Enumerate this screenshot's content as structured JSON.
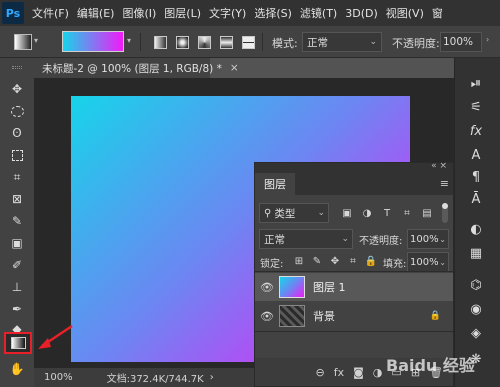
{
  "menu": {
    "logo": "Ps",
    "items": [
      "文件(F)",
      "编辑(E)",
      "图像(I)",
      "图层(L)",
      "文字(Y)",
      "选择(S)",
      "滤镜(T)",
      "3D(D)",
      "视图(V)",
      "窗"
    ]
  },
  "options": {
    "gradient_from": "#17d4ea",
    "gradient_to": "#f11bf7",
    "mode_label": "模式:",
    "mode_value": "正常",
    "opacity_label": "不透明度:",
    "opacity_value": "100%"
  },
  "document": {
    "tab_label": "未标题-2 @ 100% (图层 1, RGB/8) *",
    "close": "×",
    "zoom": "100%",
    "doc_info": "文档:372.4K/744.7K",
    "canvas_gradient": [
      "#17d4ea",
      "#6c86f2",
      "#f11bf7"
    ]
  },
  "layers_panel": {
    "title": "图层",
    "filter_label": "类型",
    "blend_mode": "正常",
    "opacity_label": "不透明度:",
    "opacity_value": "100%",
    "lock_label": "锁定:",
    "fill_label": "填充:",
    "fill_value": "100%",
    "layers": [
      {
        "name": "图层 1",
        "visible": true,
        "selected": true
      },
      {
        "name": "背景",
        "visible": true,
        "locked": true
      }
    ],
    "footer_fx": "fx"
  },
  "toolbar": {
    "icons": [
      "move-icon",
      "marquee-icon",
      "lasso-icon",
      "quick-select-icon",
      "crop-icon",
      "frame-icon",
      "eyedropper-icon",
      "patch-icon",
      "brush-icon",
      "stamp-icon",
      "history-brush-icon",
      "eraser-icon",
      "gradient-icon",
      "blur-icon"
    ]
  },
  "right_dock": {
    "fx_label": "fx",
    "type_label": "A",
    "para_label": "¶"
  },
  "watermark": "Baidu 经验"
}
